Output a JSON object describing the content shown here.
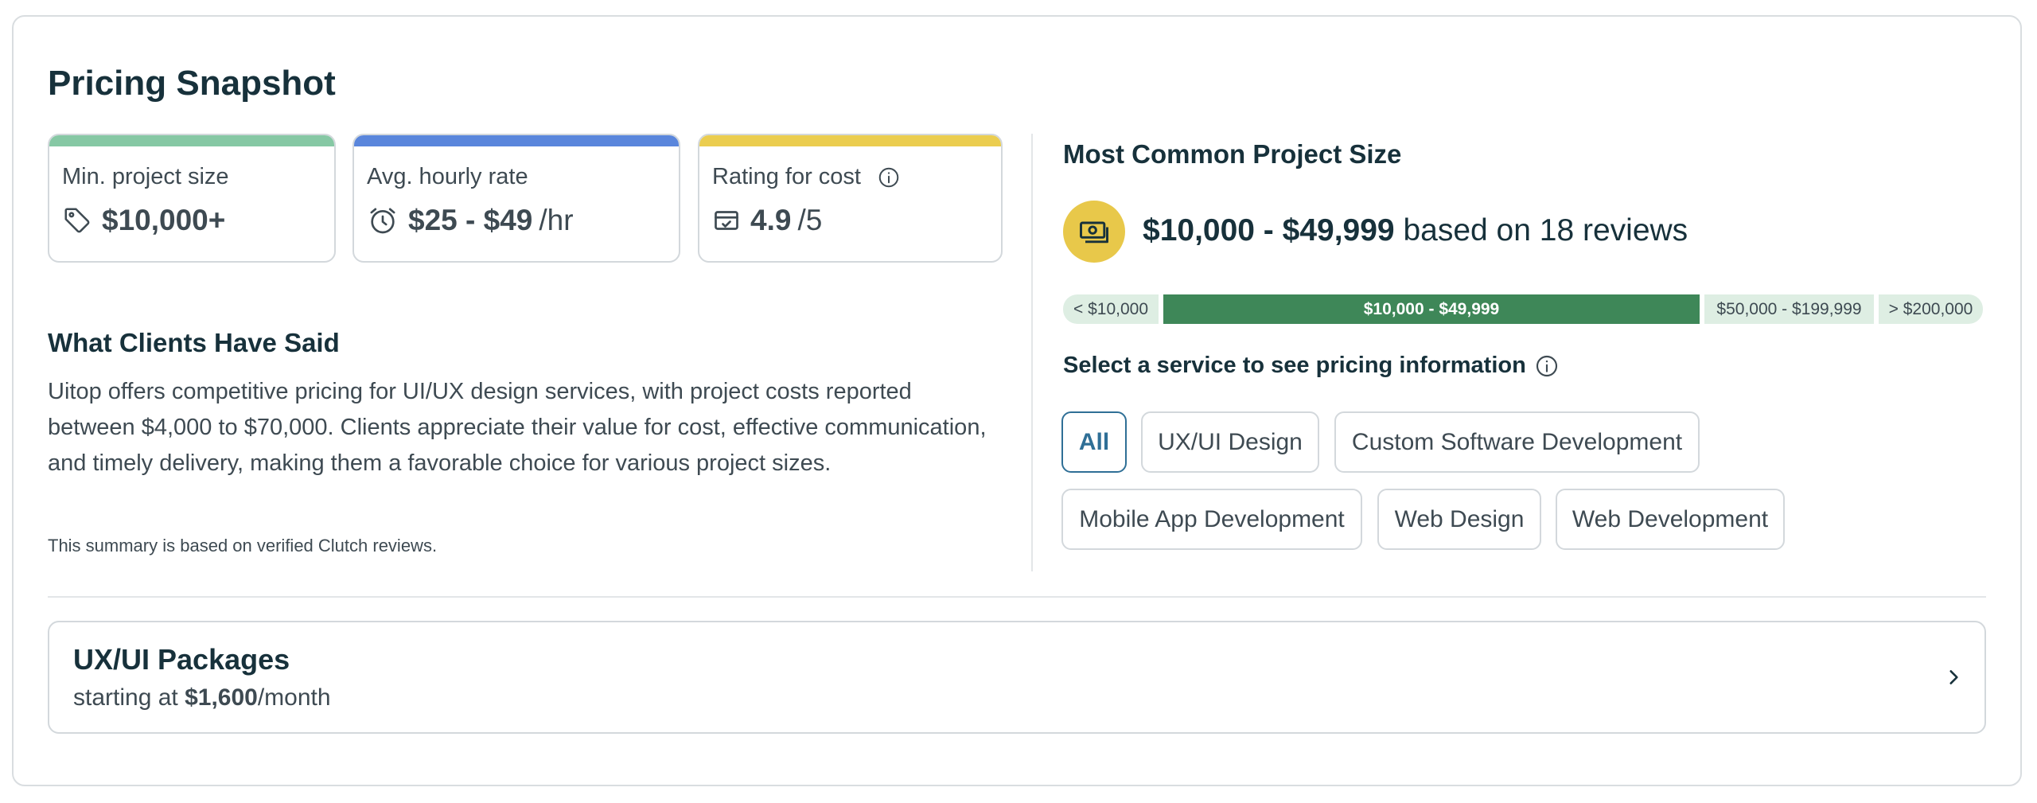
{
  "title": "Pricing Snapshot",
  "stats": {
    "min_project": {
      "label": "Min. project size",
      "value": "$10,000+",
      "icon": "price-tag-icon",
      "accent": "#86c8a4"
    },
    "hourly_rate": {
      "label": "Avg. hourly rate",
      "value": "$25 - $49",
      "unit": "/hr",
      "icon": "alarm-clock-icon",
      "accent": "#5a86dc"
    },
    "rating_cost": {
      "label": "Rating for cost",
      "value": "4.9",
      "unit": "/5",
      "icon": "wallet-check-icon",
      "info_icon": "info-icon",
      "accent": "#ebcd4f"
    }
  },
  "clients": {
    "heading": "What Clients Have Said",
    "summary": "Uitop offers competitive pricing for UI/UX design services, with project costs reported between $4,000 to $70,000. Clients appreciate their value for cost, effective communication, and timely delivery, making them a favorable choice for various project sizes.",
    "footnote": "This summary is based on verified Clutch reviews."
  },
  "common_size": {
    "heading": "Most Common Project Size",
    "range": "$10,000 - $49,999",
    "reviews_text": "based on 18 reviews",
    "icon": "money-icon",
    "icon_color": "#e8c84a",
    "segments": [
      {
        "label": "< $10,000",
        "active": false
      },
      {
        "label": "$10,000 - $49,999",
        "active": true
      },
      {
        "label": "$50,000 - $199,999",
        "active": false
      },
      {
        "label": "> $200,000",
        "active": false
      }
    ],
    "active_color": "#3e8758",
    "inactive_color": "#deeee3"
  },
  "services": {
    "label": "Select a service to see pricing information",
    "options": [
      "All",
      "UX/UI Design",
      "Custom Software Development",
      "Mobile App Development",
      "Web Design",
      "Web Development"
    ],
    "selected": "All",
    "selected_color": "#2f6f96"
  },
  "packages": {
    "title": "UX/UI Packages",
    "prefix": "starting at",
    "price": "$1,600",
    "suffix": "/month",
    "icon": "chevron-right-icon"
  }
}
